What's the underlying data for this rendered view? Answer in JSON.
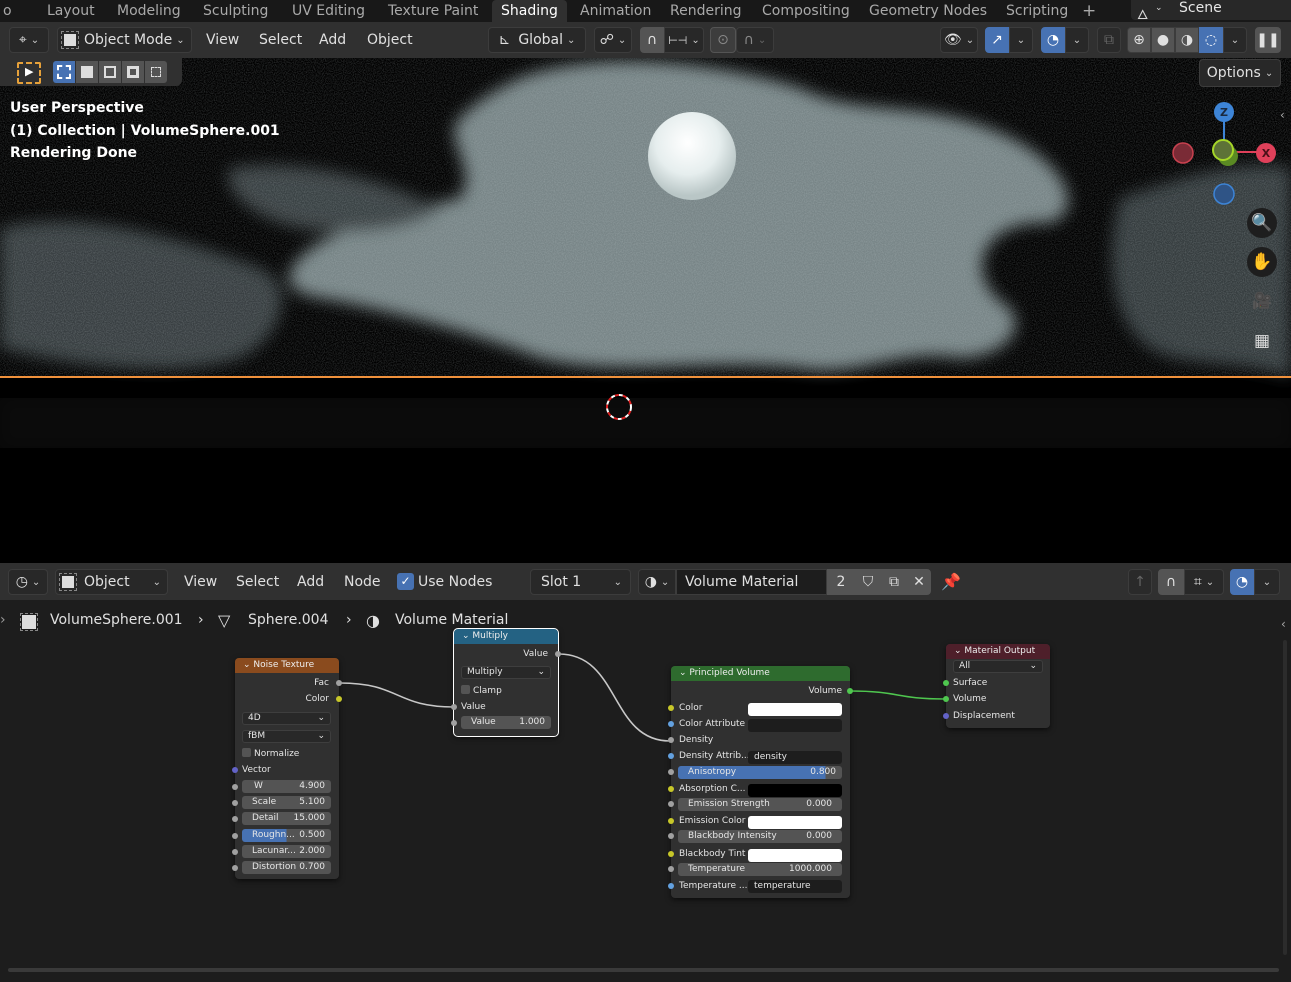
{
  "workspace_tabs": [
    "Layout",
    "Modeling",
    "Sculpting",
    "UV Editing",
    "Texture Paint",
    "Shading",
    "Animation",
    "Rendering",
    "Compositing",
    "Geometry Nodes",
    "Scripting"
  ],
  "active_workspace": "Shading",
  "add_workspace_label": "+",
  "scene": {
    "name": "Scene",
    "icon": "scene-icon"
  },
  "viewport_header": {
    "mode": "Object Mode",
    "menus": [
      "View",
      "Select",
      "Add",
      "Object"
    ],
    "transform_orientation": "Global",
    "options_label": "Options"
  },
  "viewport_overlay": {
    "line1": "User Perspective",
    "line2": "(1) Collection | VolumeSphere.001",
    "line3": "Rendering Done"
  },
  "gizmo": {
    "z": "Z",
    "x": "X"
  },
  "colors": {
    "accent": "#4772b3",
    "active_outline": "#f0913c",
    "node_noise": "#8a4b1e",
    "node_math": "#246283",
    "node_shader": "#2e6b2e",
    "node_output": "#4e1f2a"
  },
  "node_header": {
    "editor_type": "Object",
    "menus": [
      "View",
      "Select",
      "Add",
      "Node"
    ],
    "use_nodes_label": "Use Nodes",
    "use_nodes_checked": true,
    "slot": "Slot 1",
    "material_name": "Volume Material",
    "user_count": "2"
  },
  "breadcrumb": [
    {
      "label": "VolumeSphere.001",
      "icon": "object-icon"
    },
    {
      "label": "Sphere.004",
      "icon": "mesh-icon"
    },
    {
      "label": "Volume Material",
      "icon": "material-icon"
    }
  ],
  "nodes": {
    "noise": {
      "title": "Noise Texture",
      "outputs": [
        "Fac",
        "Color"
      ],
      "dimensions": "4D",
      "type": "fBM",
      "normalize_label": "Normalize",
      "vector_label": "Vector",
      "fields": [
        {
          "label": "W",
          "value": "4.900"
        },
        {
          "label": "Scale",
          "value": "5.100"
        },
        {
          "label": "Detail",
          "value": "15.000"
        },
        {
          "label": "Roughn...",
          "value": "0.500",
          "fill": 0.5
        },
        {
          "label": "Lacunar...",
          "value": "2.000"
        },
        {
          "label": "Distortion",
          "value": "0.700"
        }
      ]
    },
    "math": {
      "title": "Multiply",
      "output": "Value",
      "operation": "Multiply",
      "clamp_label": "Clamp",
      "input_label": "Value",
      "field": {
        "label": "Value",
        "value": "1.000"
      }
    },
    "volume": {
      "title": "Principled Volume",
      "output": "Volume",
      "rows": [
        {
          "label": "Color",
          "kind": "swatch",
          "value": "#ffffff"
        },
        {
          "label": "Color Attribute",
          "kind": "text",
          "value": ""
        },
        {
          "label": "Density",
          "kind": "socket"
        },
        {
          "label": "Density Attrib...",
          "kind": "text",
          "value": "density"
        },
        {
          "label": "Anisotropy",
          "kind": "slider",
          "value": "0.800",
          "fill": 0.9
        },
        {
          "label": "Absorption C...",
          "kind": "swatch",
          "value": "#000000"
        },
        {
          "label": "Emission Strength",
          "kind": "field",
          "value": "0.000"
        },
        {
          "label": "Emission Color",
          "kind": "swatch",
          "value": "#ffffff"
        },
        {
          "label": "Blackbody Intensity",
          "kind": "field",
          "value": "0.000"
        },
        {
          "label": "Blackbody Tint",
          "kind": "swatch",
          "value": "#ffffff"
        },
        {
          "label": "Temperature",
          "kind": "field",
          "value": "1000.000"
        },
        {
          "label": "Temperature ...",
          "kind": "text",
          "value": "temperature"
        }
      ]
    },
    "output": {
      "title": "Material Output",
      "target": "All",
      "inputs": [
        "Surface",
        "Volume",
        "Displacement"
      ]
    }
  }
}
